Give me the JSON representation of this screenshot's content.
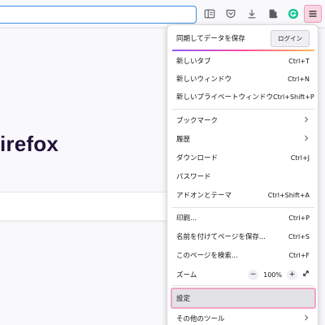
{
  "page": {
    "brand_fragment": "irefox"
  },
  "toolbar": {
    "icons": [
      "reader-view-icon",
      "pocket-icon",
      "download-icon",
      "extensions-icon",
      "grammarly-icon",
      "menu-icon"
    ]
  },
  "menu": {
    "sync_label": "同期してデータを保存",
    "login_label": "ログイン",
    "items_group1": [
      {
        "label": "新しいタブ",
        "shortcut": "Ctrl+T"
      },
      {
        "label": "新しいウィンドウ",
        "shortcut": "Ctrl+N"
      },
      {
        "label": "新しいプライベートウィンドウ",
        "shortcut": "Ctrl+Shift+P"
      }
    ],
    "items_group2": [
      {
        "label": "ブックマーク",
        "shortcut": ""
      },
      {
        "label": "履歴",
        "shortcut": ""
      },
      {
        "label": "ダウンロード",
        "shortcut": "Ctrl+J"
      },
      {
        "label": "パスワード",
        "shortcut": ""
      },
      {
        "label": "アドオンとテーマ",
        "shortcut": "Ctrl+Shift+A"
      }
    ],
    "items_group3": [
      {
        "label": "印刷...",
        "shortcut": "Ctrl+P"
      },
      {
        "label": "名前を付けてページを保存...",
        "shortcut": "Ctrl+S"
      },
      {
        "label": "このページを検索...",
        "shortcut": "Ctrl+F"
      }
    ],
    "zoom": {
      "label": "ズーム",
      "minus": "−",
      "value": "100%",
      "plus": "+"
    },
    "settings_label": "設定",
    "more_tools_label": "その他のツール"
  },
  "colors": {
    "accent": "#3c8ce8",
    "highlight_border": "#f2a4c1",
    "grammarly": "#15c39a"
  }
}
